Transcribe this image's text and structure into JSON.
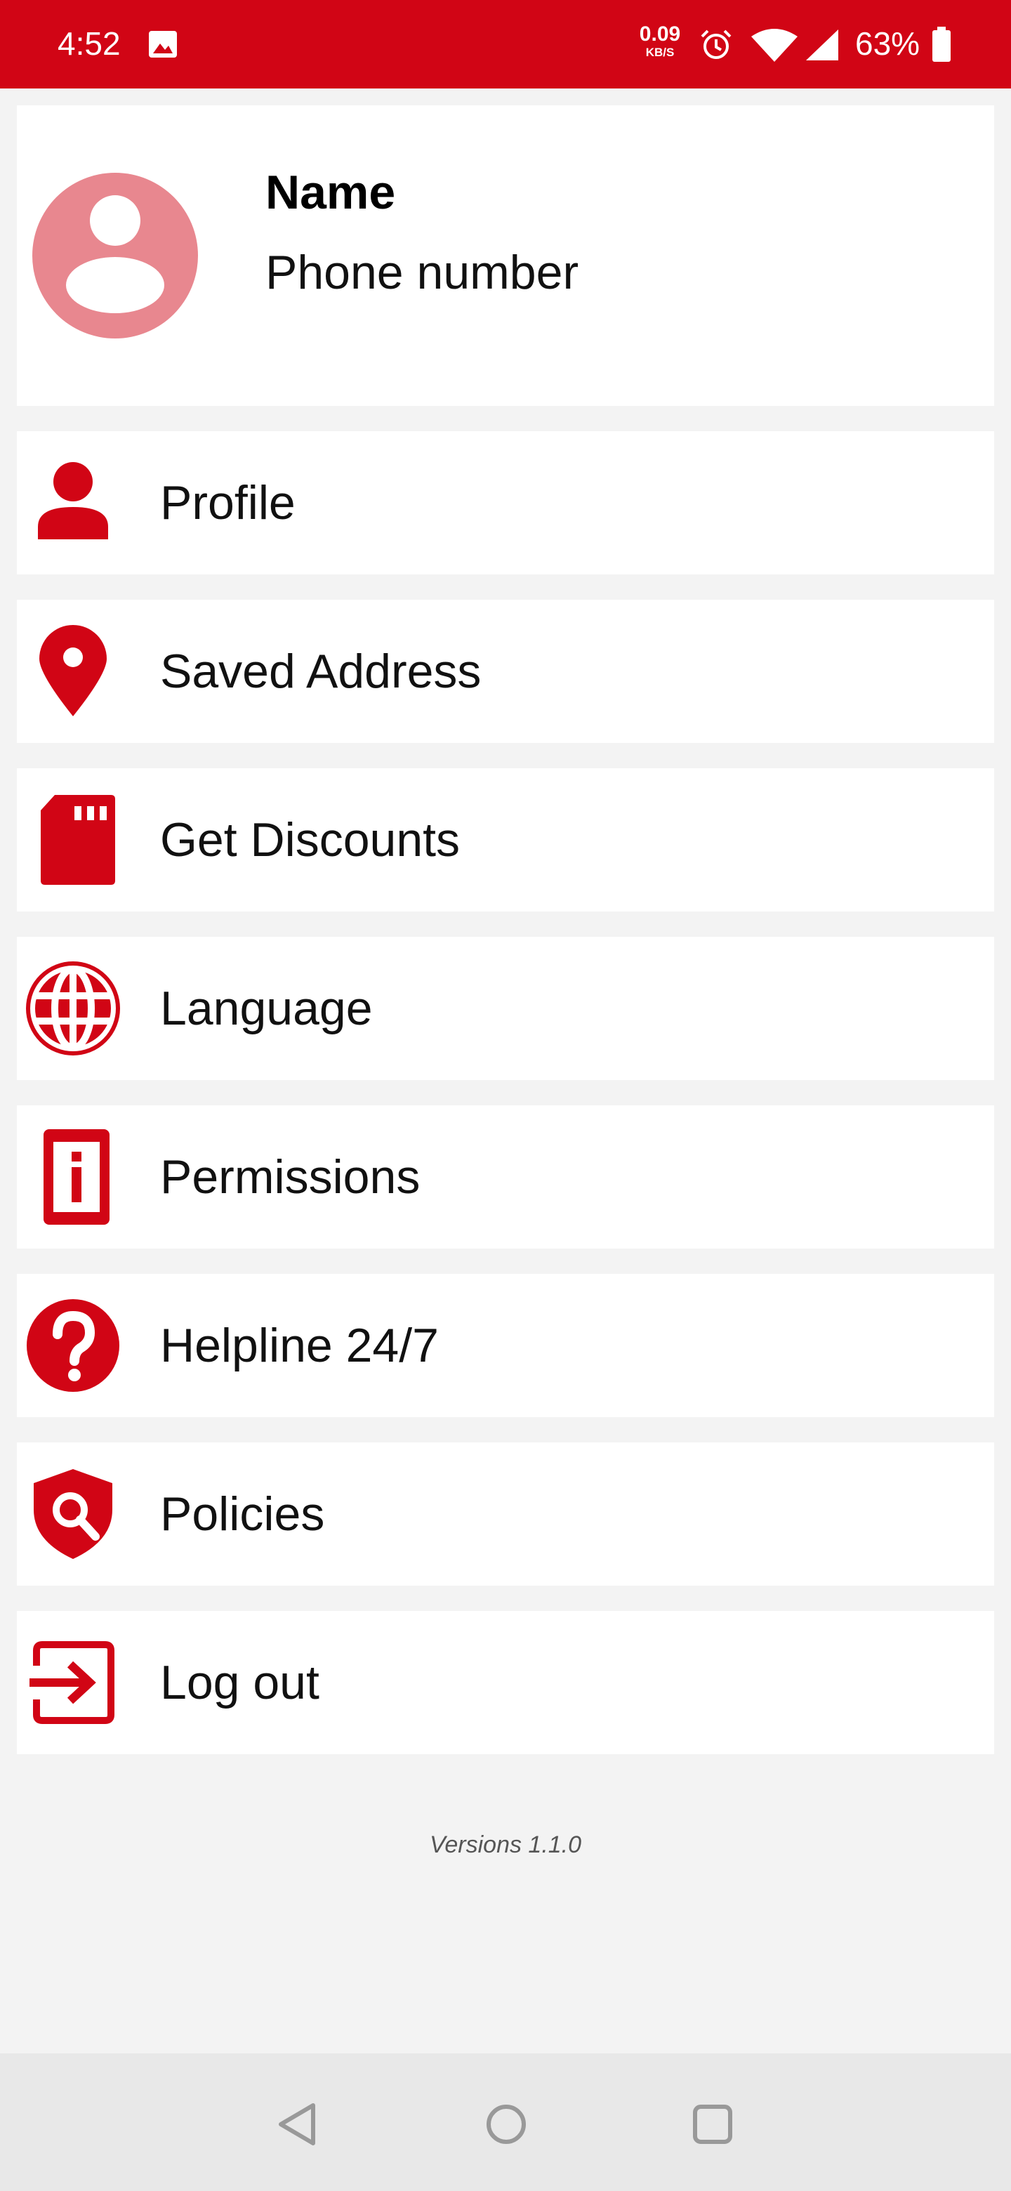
{
  "status_bar": {
    "time": "4:52",
    "net_speed_value": "0.09",
    "net_speed_unit": "KB/S",
    "battery_percent": "63%",
    "icons": [
      "gallery-icon",
      "alarm-icon",
      "wifi-icon",
      "signal-icon",
      "battery-icon"
    ]
  },
  "profile": {
    "name": "Name",
    "phone": "Phone number"
  },
  "menu": {
    "items": [
      {
        "label": "Profile",
        "icon": "person-icon"
      },
      {
        "label": "Saved Address",
        "icon": "location-pin-icon"
      },
      {
        "label": "Get Discounts",
        "icon": "sd-card-icon"
      },
      {
        "label": "Language",
        "icon": "globe-icon"
      },
      {
        "label": "Permissions",
        "icon": "info-device-icon"
      },
      {
        "label": "Helpline 24/7",
        "icon": "help-icon"
      },
      {
        "label": "Policies",
        "icon": "shield-search-icon"
      },
      {
        "label": "Log out",
        "icon": "logout-icon"
      }
    ]
  },
  "footer": {
    "version": "Versions 1.1.0"
  },
  "nav_bar": {
    "buttons": [
      "back-icon",
      "home-icon",
      "recents-icon"
    ]
  },
  "colors": {
    "accent": "#d10515",
    "avatar": "#e8878f",
    "background": "#f3f3f3"
  }
}
